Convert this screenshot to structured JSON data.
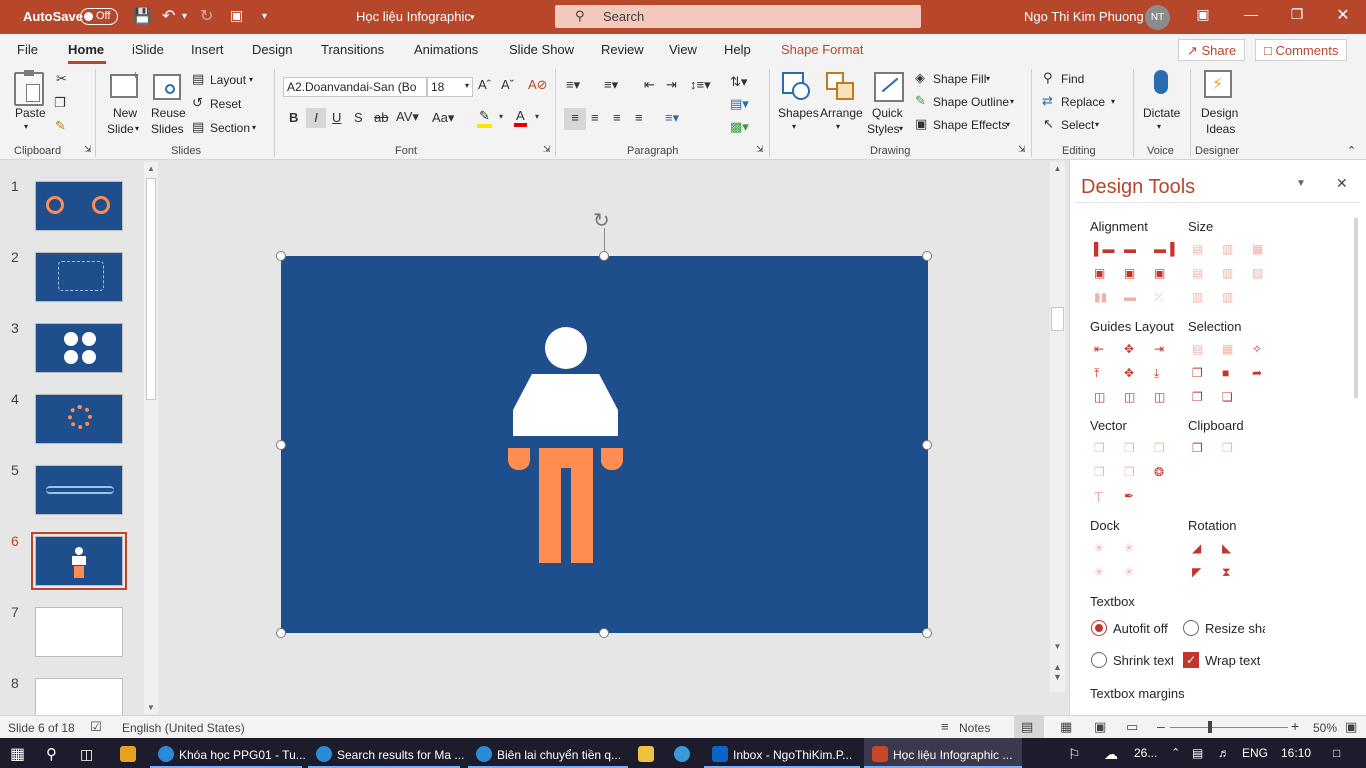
{
  "titlebar": {
    "autosave_label": "AutoSave",
    "autosave_state": "Off",
    "doc_title": "Học liệu Infographic",
    "search_placeholder": "Search",
    "user_name": "Ngo Thi Kim Phuong",
    "user_initials": "NT"
  },
  "tabs": [
    "File",
    "Home",
    "iSlide",
    "Insert",
    "Design",
    "Transitions",
    "Animations",
    "Slide Show",
    "Review",
    "View",
    "Help",
    "Shape Format"
  ],
  "top_buttons": {
    "share": "Share",
    "comments": "Comments"
  },
  "ribbon": {
    "clipboard": {
      "paste": "Paste",
      "group": "Clipboard"
    },
    "slides": {
      "new_slide": "New",
      "new_slide2": "Slide",
      "reuse": "Reuse",
      "reuse2": "Slides",
      "layout": "Layout",
      "reset": "Reset",
      "section": "Section",
      "group": "Slides"
    },
    "font": {
      "name": "A2.Doanvandai-San (Bo",
      "size": "18",
      "group": "Font"
    },
    "paragraph": {
      "group": "Paragraph"
    },
    "drawing": {
      "shapes": "Shapes",
      "arrange": "Arrange",
      "quick": "Quick",
      "quick2": "Styles",
      "fill": "Shape Fill",
      "outline": "Shape Outline",
      "effects": "Shape Effects",
      "group": "Drawing"
    },
    "editing": {
      "find": "Find",
      "replace": "Replace",
      "select": "Select",
      "group": "Editing"
    },
    "voice": {
      "dictate": "Dictate",
      "group": "Voice"
    },
    "designer": {
      "ideas": "Design",
      "ideas2": "Ideas",
      "group": "Designer"
    }
  },
  "slides": [
    {
      "num": "1",
      "style": "blue"
    },
    {
      "num": "2",
      "style": "blue"
    },
    {
      "num": "3",
      "style": "blue"
    },
    {
      "num": "4",
      "style": "blue"
    },
    {
      "num": "5",
      "style": "blue"
    },
    {
      "num": "6",
      "style": "blue",
      "selected": true
    },
    {
      "num": "7",
      "style": "white"
    },
    {
      "num": "8",
      "style": "white"
    }
  ],
  "slide_colors": {
    "background": "#1e4e8c",
    "figure_top": "#ffffff",
    "figure_bottom": "#ff8c50"
  },
  "design_tools": {
    "title": "Design Tools",
    "sections": {
      "alignment": "Alignment",
      "size": "Size",
      "guides": "Guides Layout",
      "selection": "Selection",
      "vector": "Vector",
      "clipboard": "Clipboard",
      "dock": "Dock",
      "rotation": "Rotation",
      "textbox": "Textbox",
      "margins": "Textbox margins"
    },
    "options": {
      "autofit": "Autofit off",
      "resize": "Resize shape",
      "shrink": "Shrink text",
      "wrap": "Wrap text"
    }
  },
  "statusbar": {
    "slide_info": "Slide 6 of 18",
    "language": "English (United States)",
    "notes": "Notes",
    "zoom": "50%"
  },
  "taskbar": {
    "items": [
      "Khóa học PPG01 - Tu...",
      "Search results for Ma ...",
      "Biên lai chuyển tiền q...",
      "Inbox - NgoThiKim.P...",
      "Học liệu Infographic ..."
    ],
    "weather": "26...",
    "lang": "ENG",
    "time": "16:10"
  },
  "accent_color": "#b7472a"
}
